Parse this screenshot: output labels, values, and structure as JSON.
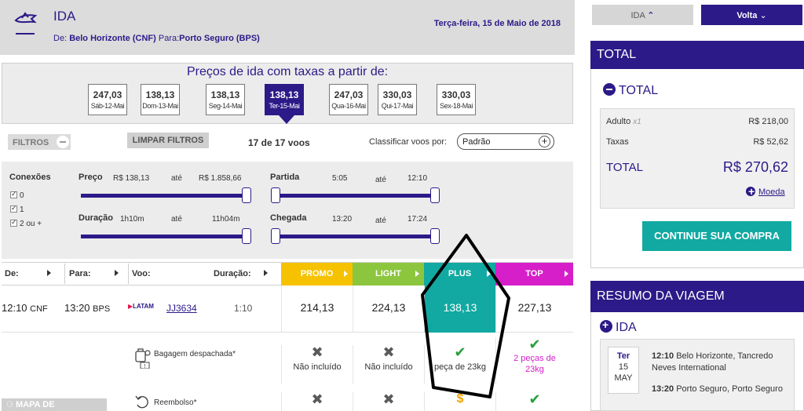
{
  "header": {
    "title": "IDA",
    "route_from_label": "De:",
    "route_from": "Belo Horizonte (CNF)",
    "route_to_label": "Para:",
    "route_to": "Porto Seguro (BPS)",
    "date": "Terça-feira, 15 de Maio de 2018"
  },
  "dates": {
    "title": "Preços de ida com taxas a partir de:",
    "items": [
      {
        "price": "247,03",
        "day": "Sáb-12-Mai"
      },
      {
        "price": "138,13",
        "day": "Dom-13-Mai"
      },
      {
        "price": "138,13",
        "day": "Seg-14-Mai"
      },
      {
        "price": "138,13",
        "day": "Ter-15-Mai",
        "selected": true
      },
      {
        "price": "247,03",
        "day": "Qua-16-Mai"
      },
      {
        "price": "330,03",
        "day": "Qui-17-Mai"
      },
      {
        "price": "330,03",
        "day": "Sex-18-Mai"
      }
    ]
  },
  "filterbar": {
    "filters_label": "FILTROS",
    "clear_label": "LIMPAR FILTROS",
    "count": "17 de 17 voos",
    "sort_label": "Classificar voos por:",
    "sort_value": "Padrão"
  },
  "filters": {
    "conexoes_label": "Conexões",
    "conexoes": [
      "0",
      "1",
      "2 ou +"
    ],
    "preco_label": "Preço",
    "preco_min": "R$ 138,13",
    "preco_max": "R$ 1.858,66",
    "ate": "até",
    "duracao_label": "Duração",
    "duracao_min": "1h10m",
    "duracao_max": "11h04m",
    "partida_label": "Partida",
    "partida_min": "5:05",
    "partida_max": "12:10",
    "chegada_label": "Chegada",
    "chegada_min": "13:20",
    "chegada_max": "17:24"
  },
  "table": {
    "headers": {
      "de": "De:",
      "para": "Para:",
      "voo": "Voo:",
      "duracao": "Duração:"
    },
    "fares": [
      "PROMO",
      "LIGHT",
      "PLUS",
      "TOP"
    ],
    "fare_colors": {
      "PROMO": "#f6c200",
      "LIGHT": "#8cc63f",
      "PLUS": "#11a9a2",
      "TOP": "#d61fc9"
    },
    "row": {
      "dep_time": "12:10",
      "dep_code": "CNF",
      "arr_time": "13:20",
      "arr_code": "BPS",
      "airline": "LATAM",
      "flight": "JJ3634",
      "duration": "1:10",
      "prices": [
        "214,13",
        "224,13",
        "138,13",
        "227,13"
      ]
    },
    "benefits": [
      {
        "label": "Bagagem despachada*",
        "values": [
          "Não incluído",
          "Não incluído",
          "peça de 23kg",
          "2 peças de 23kg"
        ]
      },
      {
        "label": "Reembolso*",
        "values": [
          "",
          "",
          "",
          ""
        ]
      }
    ],
    "map_label": "MAPA DE"
  },
  "sidebar": {
    "tab_ida": "IDA",
    "tab_volta": "Volta",
    "total_head": "TOTAL",
    "total_sub": "TOTAL",
    "adulto_label": "Adulto",
    "adulto_qty": "x1",
    "adulto_value": "R$ 218,00",
    "taxas_label": "Taxas",
    "taxas_value": "R$ 52,62",
    "total_label": "TOTAL",
    "total_value": "R$ 270,62",
    "moeda": "Moeda",
    "continue": "CONTINUE SUA COMPRA",
    "resumo_head": "RESUMO DA VIAGEM",
    "resumo_ida": "IDA",
    "day_name": "Ter",
    "day_num": "15",
    "day_month": "MAY",
    "dep_time": "12:10",
    "dep_place": "Belo Horizonte, Tancredo Neves International",
    "arr_time": "13:20",
    "arr_place": "Porto Seguro, Porto Seguro"
  }
}
